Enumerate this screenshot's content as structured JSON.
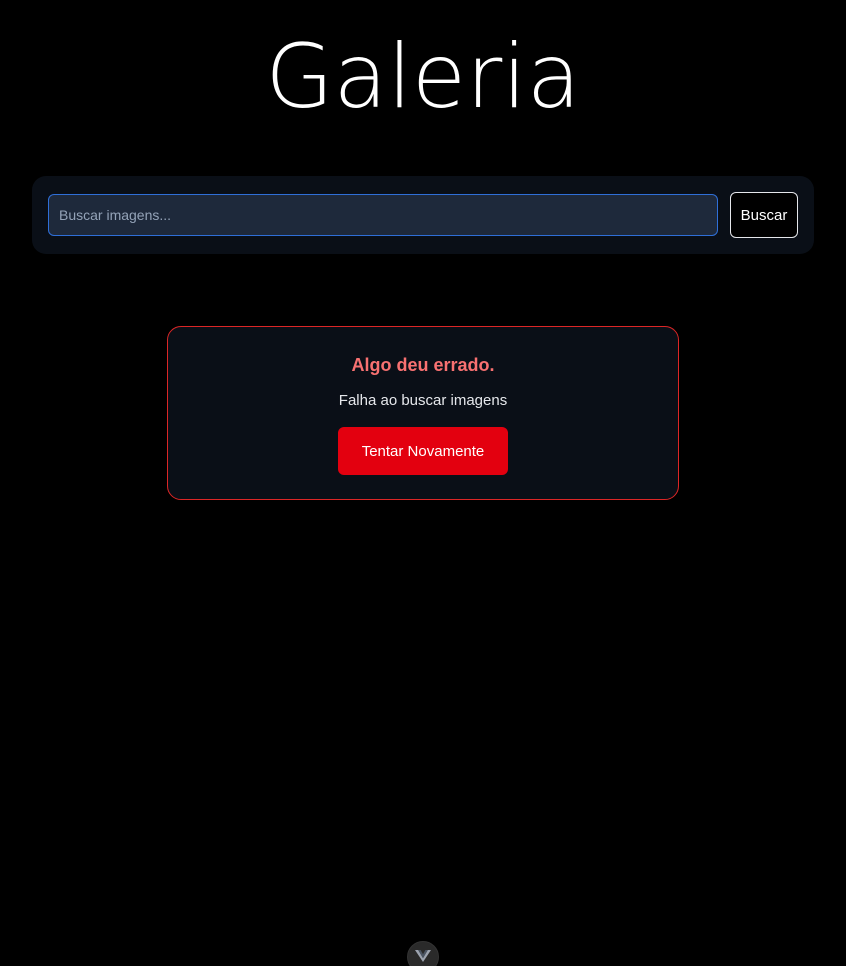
{
  "header": {
    "title": "Galeria"
  },
  "search": {
    "placeholder": "Buscar imagens...",
    "value": "",
    "button_label": "Buscar"
  },
  "error": {
    "title": "Algo deu errado.",
    "message": "Falha ao buscar imagens",
    "retry_label": "Tentar Novamente"
  },
  "colors": {
    "background": "#000000",
    "panel": "#0a0f17",
    "input_bg": "#1e293b",
    "input_border": "#2f6fd8",
    "error_border": "#dc2626",
    "error_title": "#f87171",
    "retry_button": "#e3000f"
  },
  "devtools": {
    "icon": "vue-logo-icon"
  }
}
